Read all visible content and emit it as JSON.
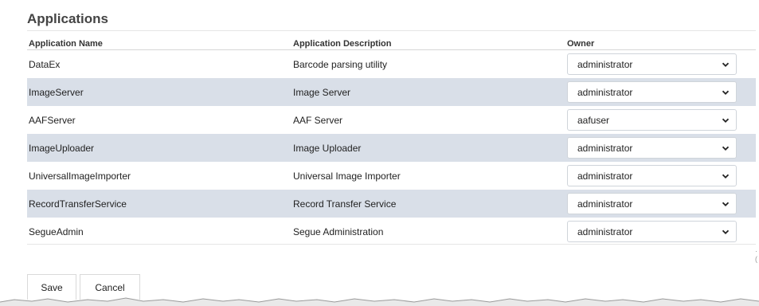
{
  "page": {
    "title": "Applications"
  },
  "table": {
    "headers": [
      "Application Name",
      "Application Description",
      "Owner"
    ],
    "rows": [
      {
        "name": "DataEx",
        "description": "Barcode parsing utility",
        "owner": "administrator"
      },
      {
        "name": "ImageServer",
        "description": "Image Server",
        "owner": "administrator"
      },
      {
        "name": "AAFServer",
        "description": "AAF Server",
        "owner": "aafuser"
      },
      {
        "name": "ImageUploader",
        "description": "Image Uploader",
        "owner": "administrator"
      },
      {
        "name": "UniversalImageImporter",
        "description": "Universal Image Importer",
        "owner": "administrator"
      },
      {
        "name": "RecordTransferService",
        "description": "Record Transfer Service",
        "owner": "administrator"
      },
      {
        "name": "SegueAdmin",
        "description": "Segue Administration",
        "owner": "administrator"
      }
    ]
  },
  "actions": {
    "save_label": "Save",
    "cancel_label": "Cancel"
  },
  "colors": {
    "row_alt": "#d9dfe8",
    "border": "#cfd4da"
  }
}
